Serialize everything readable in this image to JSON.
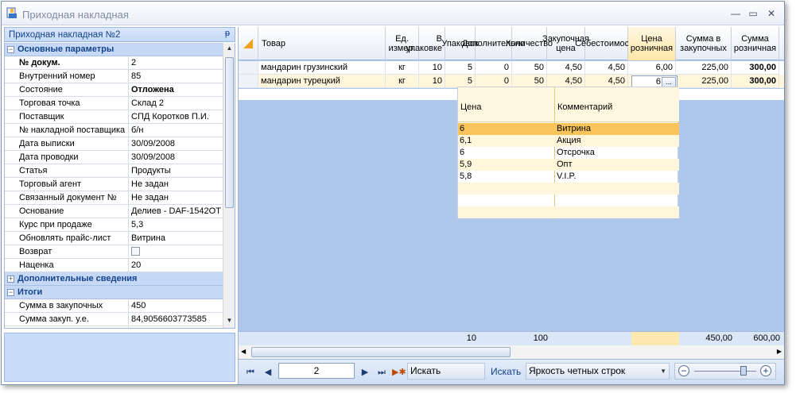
{
  "window": {
    "title": "Приходная накладная"
  },
  "left_panel": {
    "header": "Приходная накладная №2",
    "pin_glyph": "ᵽ",
    "rows": [
      {
        "type": "cat",
        "label": "Основные параметры",
        "exp": "−"
      },
      {
        "type": "prop",
        "label": "№ докум.",
        "value": "2",
        "bold_label": true
      },
      {
        "type": "prop",
        "label": "Внутренний номер",
        "value": "85"
      },
      {
        "type": "prop",
        "label": "Состояние",
        "value": "Отложена",
        "bold_value": true
      },
      {
        "type": "prop",
        "label": "Торговая точка",
        "value": "Склад 2"
      },
      {
        "type": "prop",
        "label": "Поставщик",
        "value": "СПД Коротков П.И."
      },
      {
        "type": "prop",
        "label": "№ накладной поставщика",
        "value": "б/н"
      },
      {
        "type": "prop",
        "label": "Дата выписки",
        "value": "30/09/2008"
      },
      {
        "type": "prop",
        "label": "Дата проводки",
        "value": "30/09/2008"
      },
      {
        "type": "prop",
        "label": "Статья",
        "value": "Продукты"
      },
      {
        "type": "prop",
        "label": "Торговый агент",
        "value": "Не задан"
      },
      {
        "type": "prop",
        "label": "Связанный документ №",
        "value": "Не задан"
      },
      {
        "type": "prop",
        "label": "Основание",
        "value": "Делиев - DAF-1542OT"
      },
      {
        "type": "prop",
        "label": "Курс при продаже",
        "value": "5,3"
      },
      {
        "type": "prop",
        "label": "Обновлять прайс-лист",
        "value": "Витрина"
      },
      {
        "type": "prop",
        "label": "Возврат",
        "value": "",
        "checkbox": true
      },
      {
        "type": "prop",
        "label": "Наценка",
        "value": "20"
      },
      {
        "type": "cat",
        "label": "Дополнительные сведения",
        "exp": "+"
      },
      {
        "type": "cat",
        "label": "Итоги",
        "exp": "−"
      },
      {
        "type": "prop",
        "label": "Сумма в закупочных",
        "value": "450"
      },
      {
        "type": "prop",
        "label": "Сумма закуп. у.е.",
        "value": "84,9056603773585"
      },
      {
        "type": "prop",
        "label": "",
        "value": ""
      }
    ]
  },
  "grid": {
    "columns": [
      {
        "label": "Товар",
        "w": 160,
        "align": "left-al"
      },
      {
        "label": "Ед. измер.",
        "w": 42
      },
      {
        "label": "В упаковке",
        "w": 33,
        "align": "right-al"
      },
      {
        "label": "Упаковок",
        "w": 38
      },
      {
        "label": "Дополнительно",
        "w": 46
      },
      {
        "label": "Количество",
        "w": 44
      },
      {
        "label": "Закупочная цена",
        "w": 48
      },
      {
        "label": "Себестоимость",
        "w": 54
      },
      {
        "label": "Цена розничная",
        "w": 60
      },
      {
        "label": "Сумма в закупочных",
        "w": 70
      },
      {
        "label": "Сумма розничная",
        "w": 60
      }
    ],
    "rows": [
      [
        "мандарин грузинский",
        "кг",
        "10",
        "5",
        "0",
        "50",
        "4,50",
        "4,50",
        "6,00",
        "225,00",
        "300,00"
      ],
      [
        "мандарин турецкий",
        "кг",
        "10",
        "5",
        "0",
        "50",
        "4,50",
        "4,50",
        "",
        "225,00",
        "300,00"
      ]
    ],
    "editor_value": "6",
    "editor_button": "...",
    "footer": {
      "packs": "10",
      "qty": "100",
      "sum_purchase": "450,00",
      "sum_retail": "600,00"
    }
  },
  "popup": {
    "col1": "Цена",
    "col2": "Комментарий",
    "items": [
      {
        "price": "6",
        "comment": "Витрина",
        "selected": true
      },
      {
        "price": "6,1",
        "comment": "Акция"
      },
      {
        "price": "6",
        "comment": "Отсрочка"
      },
      {
        "price": "5,9",
        "comment": "Опт"
      },
      {
        "price": "5,8",
        "comment": "V.I.P."
      }
    ]
  },
  "navigator": {
    "page": "2",
    "search_value": "Искать",
    "search_button": "Искать",
    "combo_value": "Яркость четных строк"
  }
}
